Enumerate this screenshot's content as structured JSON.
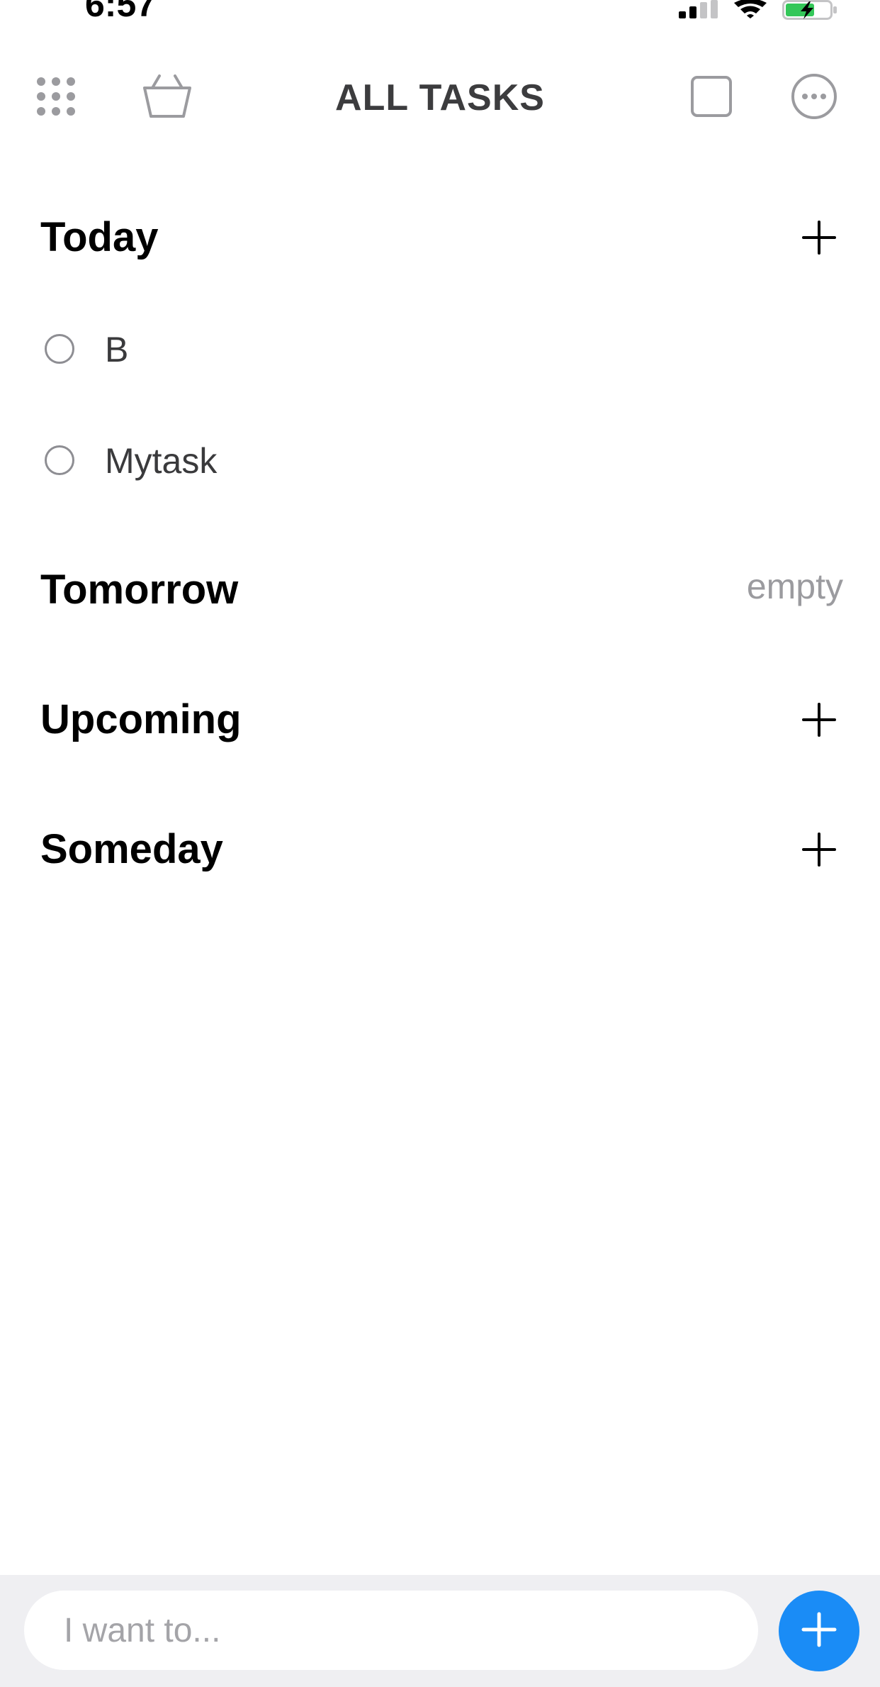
{
  "status_bar": {
    "time": "6:57",
    "icons": [
      "cellular-signal-icon",
      "wifi-icon",
      "battery-charging-icon"
    ],
    "battery_color": "#34c759"
  },
  "toolbar": {
    "title": "ALL TASKS",
    "left_icons": [
      "grid-menu-icon",
      "basket-icon"
    ],
    "right_icons": [
      "square-icon",
      "more-icon"
    ]
  },
  "sections": [
    {
      "title": "Today",
      "action": "add-icon",
      "tasks": [
        {
          "label": "B",
          "done": false
        },
        {
          "label": "Mytask",
          "done": false
        }
      ]
    },
    {
      "title": "Tomorrow",
      "status": "empty",
      "tasks": []
    },
    {
      "title": "Upcoming",
      "action": "add-icon",
      "tasks": []
    },
    {
      "title": "Someday",
      "action": "add-icon",
      "tasks": []
    }
  ],
  "bottom_bar": {
    "input_value": "",
    "input_placeholder": "I want to...",
    "accent_color": "#1a8cf6"
  }
}
